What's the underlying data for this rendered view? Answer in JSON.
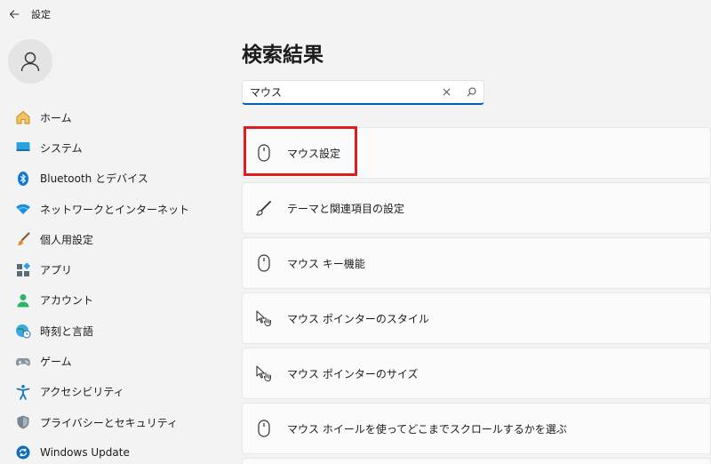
{
  "window": {
    "title": "設定"
  },
  "sidebar": {
    "items": [
      {
        "label": "ホーム",
        "icon": "home-icon"
      },
      {
        "label": "システム",
        "icon": "system-icon"
      },
      {
        "label": "Bluetooth とデバイス",
        "icon": "bluetooth-icon"
      },
      {
        "label": "ネットワークとインターネット",
        "icon": "network-icon"
      },
      {
        "label": "個人用設定",
        "icon": "brush-icon"
      },
      {
        "label": "アプリ",
        "icon": "apps-icon"
      },
      {
        "label": "アカウント",
        "icon": "account-icon"
      },
      {
        "label": "時刻と言語",
        "icon": "globe-clock-icon"
      },
      {
        "label": "ゲーム",
        "icon": "gamepad-icon"
      },
      {
        "label": "アクセシビリティ",
        "icon": "accessibility-icon"
      },
      {
        "label": "プライバシーとセキュリティ",
        "icon": "shield-icon"
      },
      {
        "label": "Windows Update",
        "icon": "update-icon"
      }
    ]
  },
  "main": {
    "title": "検索結果",
    "search": {
      "value": "マウス"
    },
    "results": [
      {
        "label": "マウス設定",
        "icon": "mouse-icon"
      },
      {
        "label": "テーマと関連項目の設定",
        "icon": "pen-icon"
      },
      {
        "label": "マウス キー機能",
        "icon": "mouse-icon"
      },
      {
        "label": "マウス ポインターのスタイル",
        "icon": "pointer-icon"
      },
      {
        "label": "マウス ポインターのサイズ",
        "icon": "pointer-icon"
      },
      {
        "label": "マウス ホイールを使ってどこまでスクロールするかを選ぶ",
        "icon": "mouse-icon"
      }
    ]
  },
  "colors": {
    "accent": "#005fb8",
    "highlight": "#e01c1c",
    "background": "#f3f3f3"
  }
}
